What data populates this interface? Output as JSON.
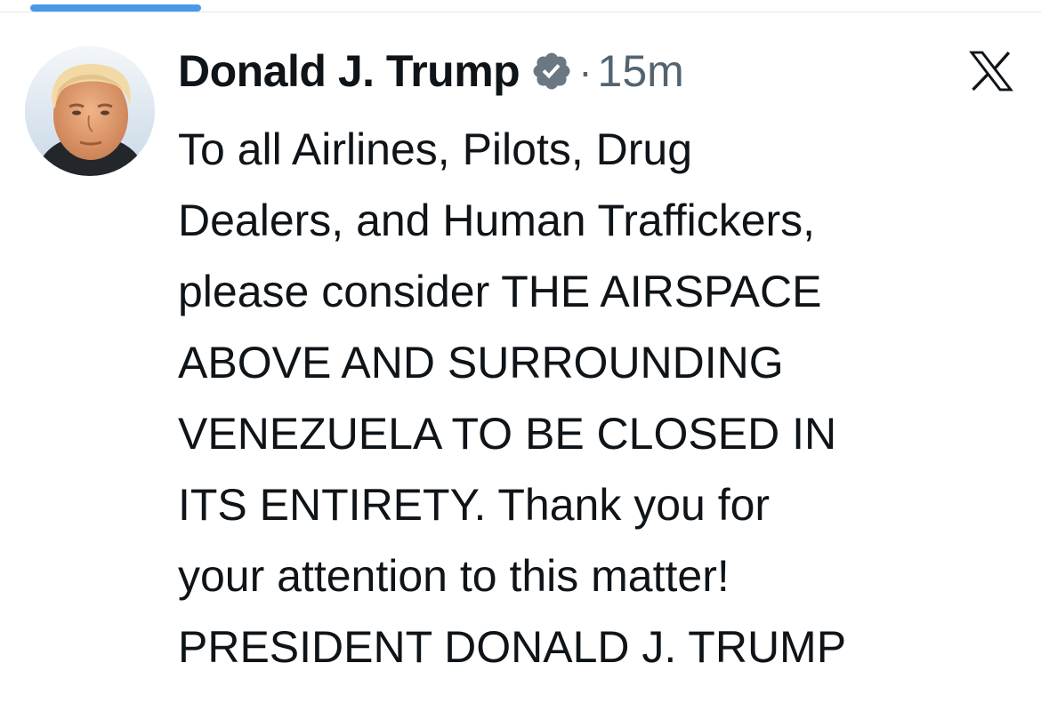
{
  "colors": {
    "tab_indicator": "#4a99e9",
    "verified_badge": "#6b7783",
    "text_primary": "#0f1419",
    "text_secondary": "#536471"
  },
  "post": {
    "author_name": "Donald J. Trump",
    "verified_icon": "verified-badge-icon",
    "separator": "·",
    "timestamp": "15m",
    "platform_icon": "x-logo-icon",
    "text_lines": [
      "To all Airlines, Pilots, Drug",
      "Dealers, and Human Traffickers,",
      "please consider THE AIRSPACE",
      "ABOVE AND SURROUNDING",
      "VENEZUELA TO BE CLOSED IN",
      "ITS ENTIRETY. Thank you for",
      "your attention to this matter!",
      "PRESIDENT DONALD J. TRUMP"
    ]
  }
}
